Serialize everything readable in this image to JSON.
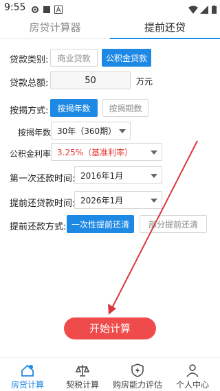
{
  "status": {
    "time": "9:55"
  },
  "tabs": [
    {
      "label": "房贷计算器",
      "active": false
    },
    {
      "label": "提前还贷",
      "active": true
    }
  ],
  "form": {
    "loan_type": {
      "label": "贷款类别:",
      "options": [
        "商业贷款",
        "公积金贷款"
      ],
      "selected": "公积金贷款"
    },
    "loan_total": {
      "label": "贷款总额:",
      "value": "50",
      "unit": "万元"
    },
    "mortgage_method": {
      "label": "按揭方式:",
      "options": [
        "按揭年数",
        "按揭期数"
      ],
      "selected": "按揭年数"
    },
    "mortgage_years": {
      "label": "按揭年数",
      "value": "30年（360期）"
    },
    "fund_rate": {
      "label": "公积金利率",
      "value": "3.25%（基准利率）"
    },
    "first_payment": {
      "label": "第一次还款时间:",
      "value": "2016年1月"
    },
    "prepay_time": {
      "label": "提前还贷款时间:",
      "value": "2026年1月"
    },
    "prepay_method": {
      "label": "提前还款方式:",
      "options": [
        "一次性提前还清",
        "部分提前还清"
      ],
      "selected": "一次性提前还清"
    }
  },
  "start_button": {
    "label": "开始计算"
  },
  "bottom_nav": [
    {
      "label": "房贷计算",
      "icon": "home-icon",
      "active": true
    },
    {
      "label": "契税计算",
      "icon": "scale-icon",
      "active": false
    },
    {
      "label": "购房能力评估",
      "icon": "shield-bolt-icon",
      "active": false
    },
    {
      "label": "个人中心",
      "icon": "person-icon",
      "active": false
    }
  ],
  "colors": {
    "accent": "#1e88e5",
    "start": "#f04b4b",
    "rate": "#e53935",
    "arrow": "#d9363e"
  }
}
